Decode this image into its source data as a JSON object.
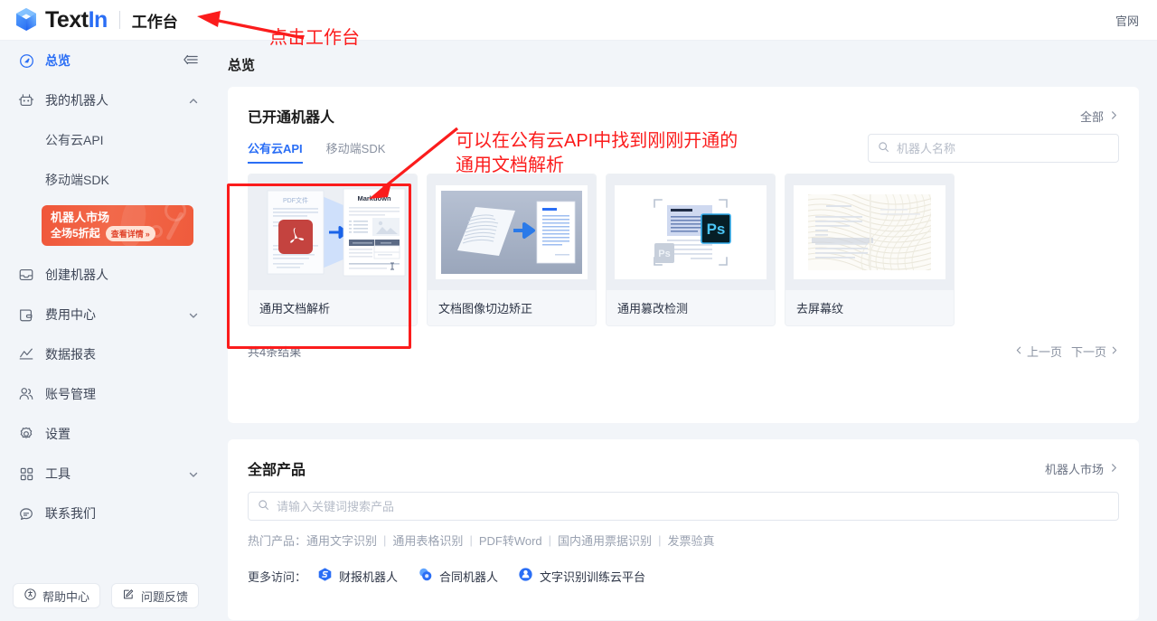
{
  "topbar": {
    "brand_part1": "Text",
    "brand_part2": "In",
    "workspace": "工作台",
    "official_site": "官网",
    "logo_icon": "cube-logo-icon"
  },
  "sidebar": {
    "overview": {
      "label": "总览",
      "icon": "compass-icon"
    },
    "collapse_icon": "collapse-panel-icon",
    "groups": [
      {
        "label": "我的机器人",
        "icon": "robot-icon",
        "expanded": true,
        "children": [
          {
            "label": "公有云API"
          },
          {
            "label": "移动端SDK"
          }
        ]
      }
    ],
    "promo": {
      "line1": "机器人市场",
      "line2": "全场5折起",
      "pill": "查看详情",
      "pill_chevron": "»"
    },
    "items": [
      {
        "label": "创建机器人",
        "icon": "inbox-icon",
        "caret": false
      },
      {
        "label": "费用中心",
        "icon": "wallet-icon",
        "caret": true
      },
      {
        "label": "数据报表",
        "icon": "chart-icon",
        "caret": false
      },
      {
        "label": "账号管理",
        "icon": "users-icon",
        "caret": false
      },
      {
        "label": "设置",
        "icon": "gear-icon",
        "caret": false
      },
      {
        "label": "工具",
        "icon": "grid-icon",
        "caret": true
      },
      {
        "label": "联系我们",
        "icon": "chat-icon",
        "caret": false
      }
    ],
    "footer_buttons": [
      {
        "label": "帮助中心",
        "icon": "help-circle-icon"
      },
      {
        "label": "问题反馈",
        "icon": "edit-pencil-icon"
      }
    ]
  },
  "main": {
    "page_title": "总览",
    "robots_panel": {
      "title": "已开通机器人",
      "all_link": "全部",
      "all_link_icon": "chevron-right-icon",
      "tabs": [
        {
          "label": "公有云API",
          "selected": true
        },
        {
          "label": "移动端SDK",
          "selected": false
        }
      ],
      "search": {
        "placeholder": "机器人名称",
        "value": "",
        "icon": "search-icon"
      },
      "cards": [
        {
          "name": "通用文档解析",
          "thumb": "pdf-to-markdown-thumb",
          "highlighted": true
        },
        {
          "name": "文档图像切边矫正",
          "thumb": "document-dewarp-thumb",
          "highlighted": false
        },
        {
          "name": "通用篡改检测",
          "thumb": "tamper-detect-ps-thumb",
          "highlighted": false
        },
        {
          "name": "去屏幕纹",
          "thumb": "moire-removal-thumb",
          "highlighted": false
        }
      ],
      "result_count": "共4条结果",
      "prev_page": "上一页",
      "next_page": "下一页",
      "prev_icon": "chevron-left-icon",
      "next_icon": "chevron-right-icon"
    },
    "products_panel": {
      "title": "全部产品",
      "market_link": "机器人市场",
      "market_link_icon": "chevron-right-icon",
      "search": {
        "placeholder": "请输入关键词搜索产品",
        "value": "",
        "icon": "search-icon"
      },
      "hot_label": "热门产品：",
      "hot_items": [
        "通用文字识别",
        "通用表格识别",
        "PDF转Word",
        "国内通用票据识别",
        "发票验真"
      ],
      "more_label": "更多访问：",
      "more_links": [
        {
          "label": "财报机器人",
          "icon": "finance-robot-icon",
          "color": "#2a6ef5"
        },
        {
          "label": "合同机器人",
          "icon": "contract-robot-icon",
          "color": "#3d87fa"
        },
        {
          "label": "文字识别训练云平台",
          "icon": "ocr-cloud-icon",
          "color": "#2a6ef5"
        }
      ]
    }
  },
  "annotations": [
    {
      "text": "点击工作台",
      "color": "#fb1c1c"
    },
    {
      "text": "可以在公有云API中找到刚刚开通的\n通用文档解析",
      "color": "#fb1c1c"
    }
  ],
  "colors": {
    "accent": "#2a6ef5",
    "annotation": "#fb1c1c",
    "page_bg": "#f2f5f9",
    "promo_bg": "#f0573a"
  }
}
